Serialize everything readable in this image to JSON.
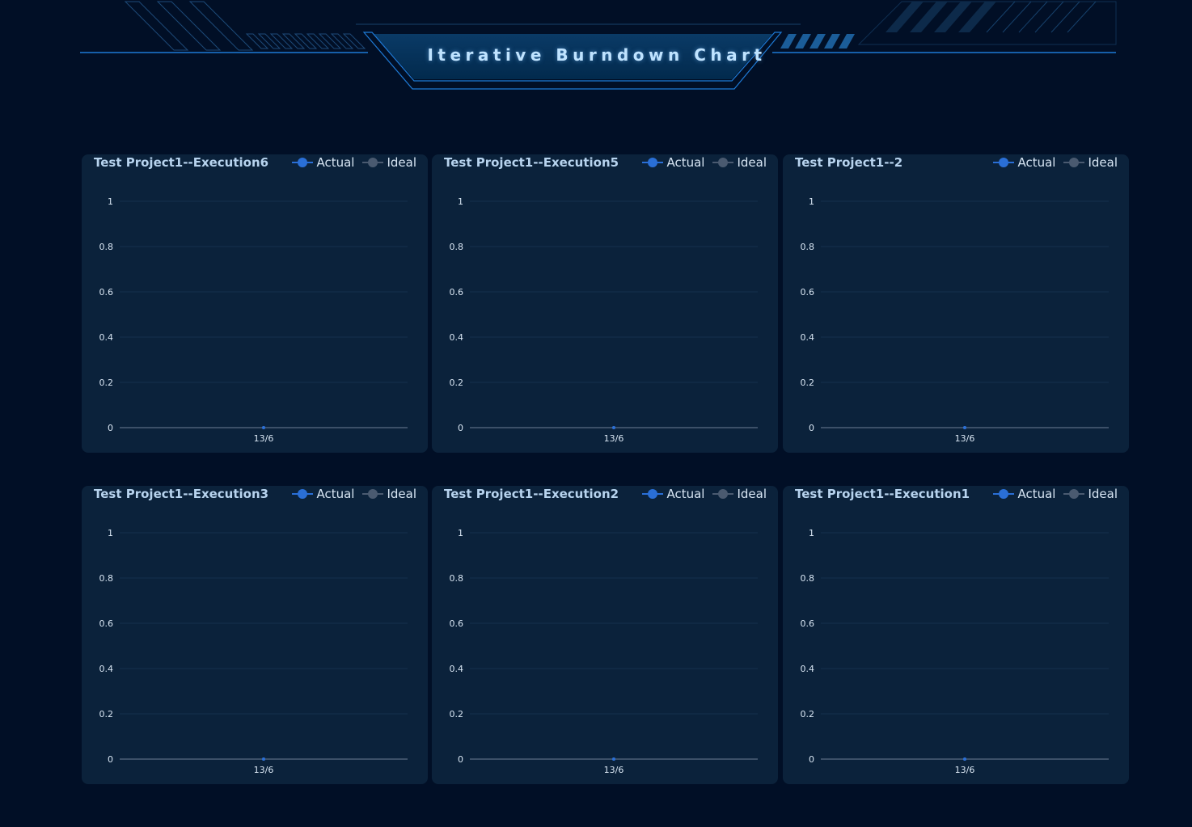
{
  "page": {
    "title": "Iterative Burndown Chart"
  },
  "colors": {
    "background": "#010f26",
    "panel": "#0b223b",
    "actual": "#2a6fd6",
    "ideal": "#4a5a70",
    "accent_line": "#1e7ad6"
  },
  "legend": {
    "actual_label": "Actual",
    "ideal_label": "Ideal"
  },
  "chart_data": [
    {
      "type": "line",
      "title": "Test Project1--Execution6",
      "categories": [
        "13/6"
      ],
      "series": [
        {
          "name": "Actual",
          "values": [
            0
          ]
        },
        {
          "name": "Ideal",
          "values": [
            0
          ]
        }
      ],
      "yticks": [
        "0",
        "0.2",
        "0.4",
        "0.6",
        "0.8",
        "1"
      ],
      "ylim": [
        0,
        1
      ],
      "grid": true,
      "legend_position": "top-right"
    },
    {
      "type": "line",
      "title": "Test Project1--Execution5",
      "categories": [
        "13/6"
      ],
      "series": [
        {
          "name": "Actual",
          "values": [
            0
          ]
        },
        {
          "name": "Ideal",
          "values": [
            0
          ]
        }
      ],
      "yticks": [
        "0",
        "0.2",
        "0.4",
        "0.6",
        "0.8",
        "1"
      ],
      "ylim": [
        0,
        1
      ],
      "grid": true,
      "legend_position": "top-right"
    },
    {
      "type": "line",
      "title": "Test Project1--2",
      "categories": [
        "13/6"
      ],
      "series": [
        {
          "name": "Actual",
          "values": [
            0
          ]
        },
        {
          "name": "Ideal",
          "values": [
            0
          ]
        }
      ],
      "yticks": [
        "0",
        "0.2",
        "0.4",
        "0.6",
        "0.8",
        "1"
      ],
      "ylim": [
        0,
        1
      ],
      "grid": true,
      "legend_position": "top-right"
    },
    {
      "type": "line",
      "title": "Test Project1--Execution3",
      "categories": [
        "13/6"
      ],
      "series": [
        {
          "name": "Actual",
          "values": [
            0
          ]
        },
        {
          "name": "Ideal",
          "values": [
            0
          ]
        }
      ],
      "yticks": [
        "0",
        "0.2",
        "0.4",
        "0.6",
        "0.8",
        "1"
      ],
      "ylim": [
        0,
        1
      ],
      "grid": true,
      "legend_position": "top-right"
    },
    {
      "type": "line",
      "title": "Test Project1--Execution2",
      "categories": [
        "13/6"
      ],
      "series": [
        {
          "name": "Actual",
          "values": [
            0
          ]
        },
        {
          "name": "Ideal",
          "values": [
            0
          ]
        }
      ],
      "yticks": [
        "0",
        "0.2",
        "0.4",
        "0.6",
        "0.8",
        "1"
      ],
      "ylim": [
        0,
        1
      ],
      "grid": true,
      "legend_position": "top-right"
    },
    {
      "type": "line",
      "title": "Test Project1--Execution1",
      "categories": [
        "13/6"
      ],
      "series": [
        {
          "name": "Actual",
          "values": [
            0
          ]
        },
        {
          "name": "Ideal",
          "values": [
            0
          ]
        }
      ],
      "yticks": [
        "0",
        "0.2",
        "0.4",
        "0.6",
        "0.8",
        "1"
      ],
      "ylim": [
        0,
        1
      ],
      "grid": true,
      "legend_position": "top-right"
    }
  ]
}
